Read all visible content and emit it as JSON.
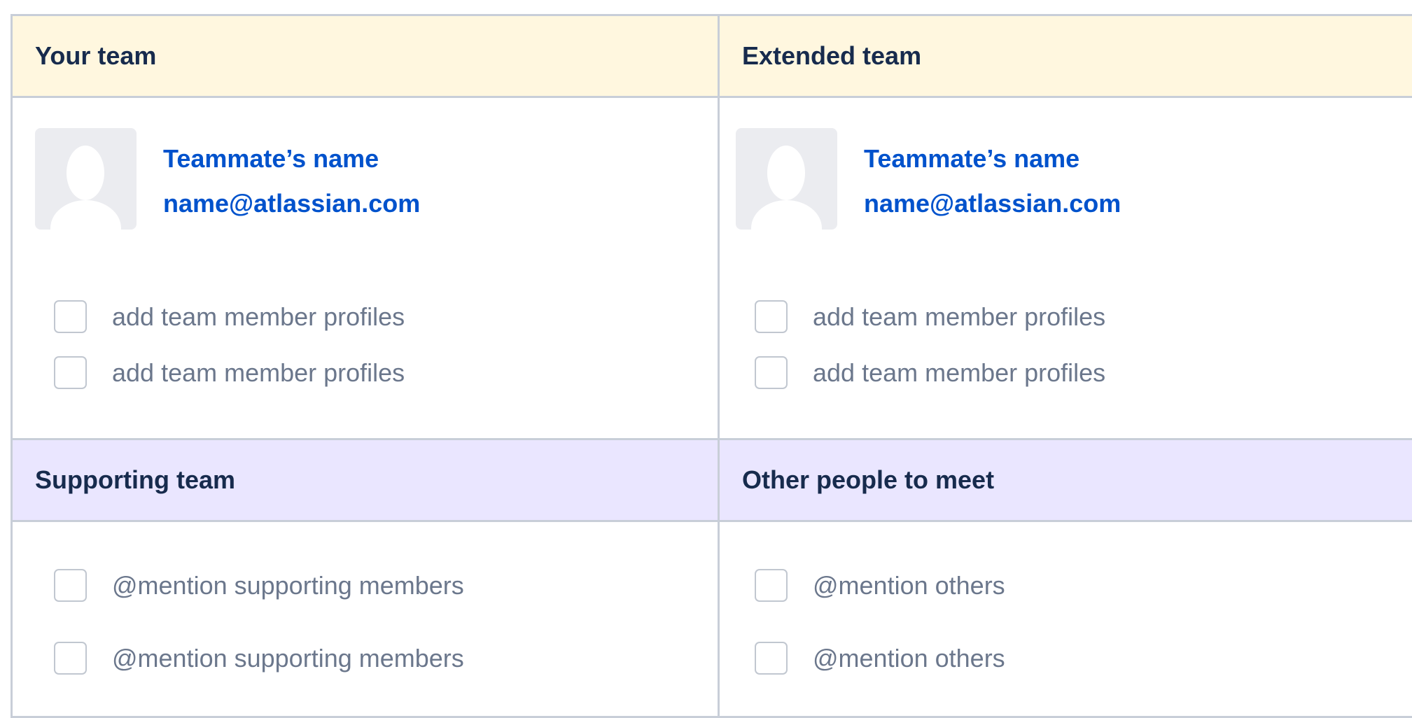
{
  "sections": {
    "your_team": {
      "title": "Your team",
      "profile": {
        "name": "Teammate’s name",
        "email": "name@atlassian.com"
      },
      "tasks": [
        "add team member profiles",
        "add team member profiles"
      ]
    },
    "extended_team": {
      "title": "Extended team",
      "profile": {
        "name": "Teammate’s name",
        "email": "name@atlassian.com"
      },
      "tasks": [
        "add team member profiles",
        "add team member profiles"
      ]
    },
    "supporting_team": {
      "title": "Supporting team",
      "tasks": [
        "@mention supporting members",
        "@mention supporting members"
      ]
    },
    "other_people": {
      "title": "Other people to meet",
      "tasks": [
        "@mention others",
        "@mention others"
      ]
    }
  },
  "colors": {
    "header_yellow": "#fff7df",
    "header_purple": "#eae6ff",
    "link_blue": "#0052cc",
    "heading_text": "#172b4d",
    "muted_text": "#6b778c",
    "border": "#c8ced8"
  },
  "icons": {
    "avatar": "person-placeholder-icon",
    "task": "checkbox-icon"
  }
}
